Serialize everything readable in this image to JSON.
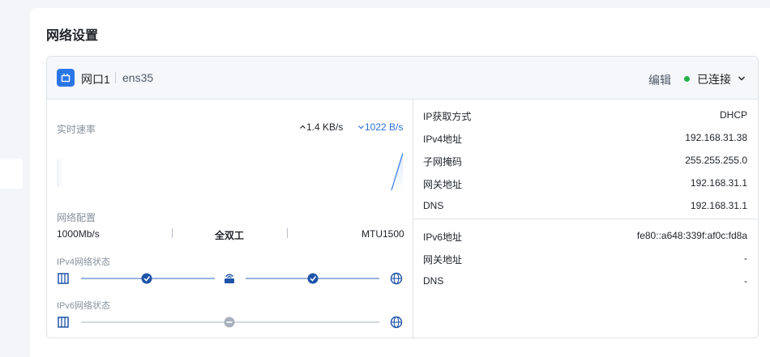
{
  "page": {
    "title": "网络设置"
  },
  "port": {
    "name": "网口1",
    "interface": "ens35",
    "edit_label": "编辑",
    "status": "已连接",
    "status_color": "#21b24b"
  },
  "rate": {
    "label": "实时速率",
    "upload": "1.4 KB/s",
    "download": "1022 B/s"
  },
  "config": {
    "label": "网络配置",
    "speed": "1000Mb/s",
    "duplex": "全双工",
    "mtu": "MTU1500"
  },
  "ipv4_status": {
    "label": "IPv4网络状态"
  },
  "ipv6_status": {
    "label": "IPv6网络状态"
  },
  "ipv4": [
    {
      "key": "IP获取方式",
      "value": "DHCP"
    },
    {
      "key": "IPv4地址",
      "value": "192.168.31.38"
    },
    {
      "key": "子网掩码",
      "value": "255.255.255.0"
    },
    {
      "key": "网关地址",
      "value": "192.168.31.1"
    },
    {
      "key": "DNS",
      "value": "192.168.31.1"
    }
  ],
  "ipv6": [
    {
      "key": "IPv6地址",
      "value": "fe80::a648:339f:af0c:fd8a"
    },
    {
      "key": "网关地址",
      "value": "-"
    },
    {
      "key": "DNS",
      "value": "-"
    }
  ],
  "colors": {
    "accent": "#2a76e8",
    "check": "#1f54a8",
    "disabled": "#a9b1bd"
  }
}
